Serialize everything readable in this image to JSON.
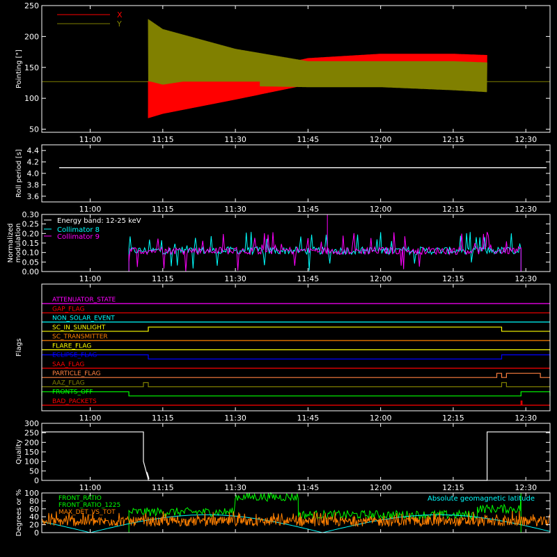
{
  "background": "#000000",
  "foreground": "#ffffff",
  "time_axis": {
    "start": "10:50",
    "end": "12:35",
    "ticks": [
      "11:00",
      "11:15",
      "11:30",
      "11:45",
      "12:00",
      "12:15",
      "12:30"
    ]
  },
  "chart_data": [
    {
      "id": "pointing",
      "type": "line",
      "title": "",
      "xlabel": "",
      "ylabel": "Pointing [\"]",
      "ylim": [
        45,
        250
      ],
      "yticks": [
        "50",
        "100",
        "150",
        "200",
        "250"
      ],
      "legend_placement": "top-left",
      "series": [
        {
          "name": "X",
          "color": "#ff0000",
          "envelope": [
            {
              "t": "11:12",
              "low": 68,
              "high": 128
            },
            {
              "t": "11:15",
              "low": 75,
              "high": 122
            },
            {
              "t": "11:30",
              "low": 98,
              "high": 140
            },
            {
              "t": "11:45",
              "low": 122,
              "high": 165
            },
            {
              "t": "12:00",
              "low": 125,
              "high": 172
            },
            {
              "t": "12:15",
              "low": 125,
              "high": 172
            },
            {
              "t": "12:22",
              "low": 125,
              "high": 170
            }
          ]
        },
        {
          "name": "Y",
          "color": "#808000",
          "envelope": [
            {
              "t": "11:12",
              "low": 128,
              "high": 228
            },
            {
              "t": "11:15",
              "low": 112,
              "high": 212
            },
            {
              "t": "11:30",
              "low": 120,
              "high": 180
            },
            {
              "t": "11:45",
              "low": 118,
              "high": 160
            },
            {
              "t": "12:00",
              "low": 118,
              "high": 160
            },
            {
              "t": "12:15",
              "low": 113,
              "high": 160
            },
            {
              "t": "12:22",
              "low": 110,
              "high": 158
            }
          ]
        },
        {
          "name": "",
          "color": "#808000",
          "baseline": 127
        }
      ]
    },
    {
      "id": "roll-period",
      "type": "line",
      "title": "",
      "xlabel": "",
      "ylabel": "Roll period [s]",
      "ylim": [
        3.5,
        4.5
      ],
      "yticks": [
        "3.6",
        "3.8",
        "4.0",
        "4.2",
        "4.4"
      ],
      "series": [
        {
          "name": "",
          "color": "#ffffff",
          "constant": 4.1
        }
      ]
    },
    {
      "id": "modulation",
      "type": "line",
      "title": "",
      "xlabel": "",
      "ylabel": "Normalized modulation",
      "ylim": [
        0,
        0.3
      ],
      "yticks": [
        "0.00",
        "0.05",
        "0.10",
        "0.15",
        "0.20",
        "0.25",
        "0.30"
      ],
      "annotation": "Energy band: 12-25 keV",
      "legend_placement": "top-left",
      "active_range": [
        "11:08",
        "12:29"
      ],
      "series": [
        {
          "name": "Collimator 8",
          "color": "#00ffff",
          "base": 0.09
        },
        {
          "name": "Collimator 9",
          "color": "#ff00ff",
          "base": 0.09
        }
      ]
    },
    {
      "id": "flags",
      "type": "line",
      "title": "",
      "xlabel": "",
      "ylabel": "Flags",
      "series": [
        {
          "name": "ATTENUATOR_STATE",
          "color": "#ff00ff",
          "on": []
        },
        {
          "name": "GAP_FLAG",
          "color": "#ff0000",
          "on": []
        },
        {
          "name": "NON_SOLAR_EVENT",
          "color": "#00ffff",
          "on": []
        },
        {
          "name": "SC_IN_SUNLIGHT",
          "color": "#ffff00",
          "on": [
            [
              "11:12",
              "12:25"
            ]
          ]
        },
        {
          "name": "SC_TRANSMITTER",
          "color": "#ff8000",
          "on": []
        },
        {
          "name": "FLARE_FLAG",
          "color": "#ffff00",
          "on": []
        },
        {
          "name": "ECLIPSE_FLAG",
          "color": "#0000ff",
          "on": [
            [
              "10:50",
              "11:12"
            ],
            [
              "12:25",
              "12:35"
            ]
          ]
        },
        {
          "name": "SAA_FLAG",
          "color": "#ff0000",
          "on": []
        },
        {
          "name": "PARTICLE_FLAG",
          "color": "#ff8040",
          "on": [
            [
              "12:24",
              "12:25"
            ],
            [
              "12:26",
              "12:33"
            ]
          ]
        },
        {
          "name": "AAZ_FLAG",
          "color": "#808000",
          "on": [
            [
              "11:11",
              "11:12"
            ],
            [
              "12:25",
              "12:26"
            ]
          ]
        },
        {
          "name": "FRONTS_OFF",
          "color": "#00ff00",
          "on": [
            [
              "10:50",
              "11:08"
            ],
            [
              "12:29",
              "12:35"
            ]
          ]
        },
        {
          "name": "BAD_PACKETS",
          "color": "#ff0000",
          "on": [
            [
              "12:29",
              "12:29"
            ]
          ]
        }
      ]
    },
    {
      "id": "quality",
      "type": "line",
      "title": "",
      "xlabel": "",
      "ylabel": "Quality",
      "ylim": [
        0,
        300
      ],
      "yticks": [
        "0",
        "50",
        "100",
        "150",
        "200",
        "250",
        "300"
      ],
      "series": [
        {
          "name": "",
          "color": "#ffffff",
          "points": [
            {
              "t": "10:50",
              "v": 255
            },
            {
              "t": "11:11",
              "v": 255
            },
            {
              "t": "11:11",
              "v": 100
            },
            {
              "t": "11:12",
              "v": 5
            },
            {
              "t": "11:12",
              "v": 0
            },
            {
              "t": "12:22",
              "v": 0
            },
            {
              "t": "12:22",
              "v": 255
            },
            {
              "t": "12:35",
              "v": 255
            }
          ]
        }
      ]
    },
    {
      "id": "ratios",
      "type": "line",
      "title": "",
      "xlabel": "",
      "ylabel": "Degrees or %",
      "ylim": [
        0,
        100
      ],
      "yticks": [
        "0",
        "20",
        "40",
        "60",
        "80",
        "100"
      ],
      "legend_placement": "top-left",
      "annotation": "Absolute geomagnetic latitude",
      "annotation_color": "#00ffff",
      "series": [
        {
          "name": "FRONT_RATIO",
          "color": "#00ff00",
          "levels": [
            {
              "from": "11:08",
              "to": "11:30",
              "v": 52
            },
            {
              "from": "11:30",
              "to": "11:43",
              "v": 90
            },
            {
              "from": "11:43",
              "to": "12:20",
              "v": 45
            },
            {
              "from": "12:20",
              "to": "12:29",
              "v": 60
            }
          ]
        },
        {
          "name": "FRONT_RATIO_1225",
          "color": "#00ff00"
        },
        {
          "name": "MAX_DET_VS_TOT",
          "color": "#ff8000",
          "base": 28
        },
        {
          "name": "Absolute geomagnetic latitude",
          "color": "#00ffff",
          "amplitude": 45
        }
      ]
    }
  ]
}
